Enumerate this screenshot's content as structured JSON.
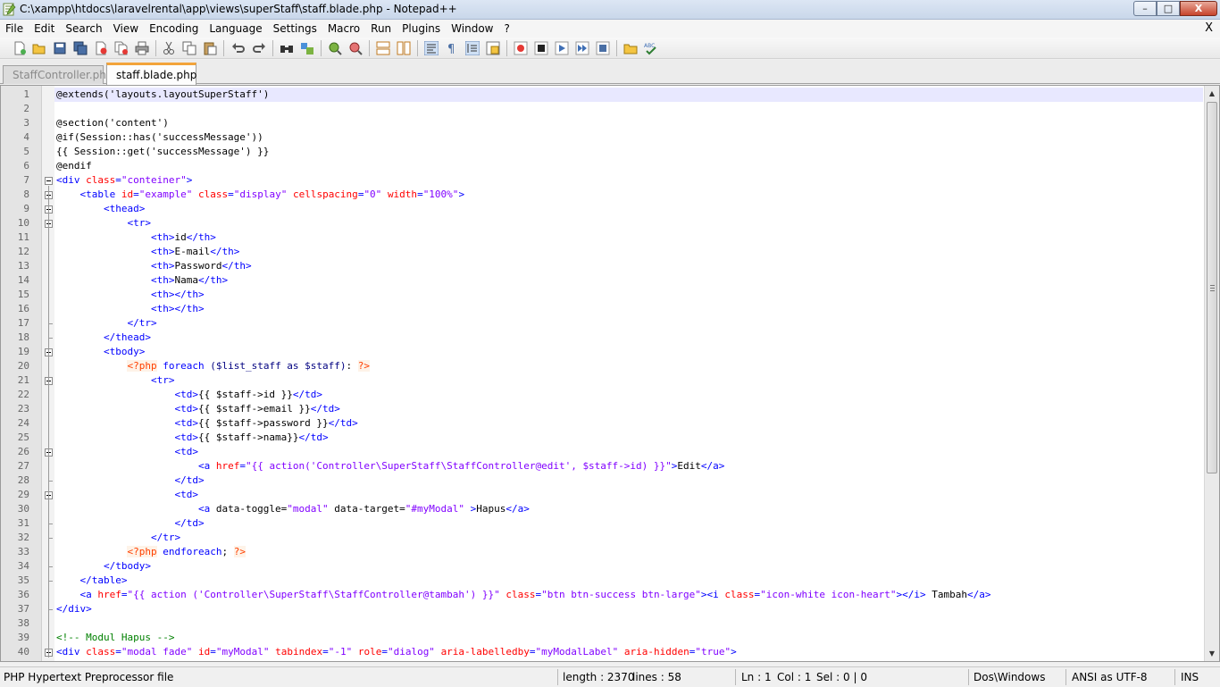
{
  "window": {
    "title": "C:\\xampp\\htdocs\\laravelrental\\app\\views\\superStaff\\staff.blade.php - Notepad++",
    "min_glyph": "–",
    "max_glyph": "□",
    "close_glyph": "X"
  },
  "menu": {
    "items": [
      "File",
      "Edit",
      "Search",
      "View",
      "Encoding",
      "Language",
      "Settings",
      "Macro",
      "Run",
      "Plugins",
      "Window",
      "?"
    ],
    "close_label": "X"
  },
  "toolbar": {
    "buttons": [
      "new-file",
      "open-file",
      "save",
      "save-all",
      "close",
      "close-all",
      "print",
      "cut",
      "copy",
      "paste",
      "undo",
      "redo",
      "find",
      "replace",
      "zoom-in",
      "zoom-out",
      "sync-vertical",
      "sync-horizontal",
      "word-wrap",
      "show-all-chars",
      "indent-guide",
      "user-defined-lang",
      "record-macro",
      "stop-record",
      "play-macro",
      "run-macro-multiple",
      "save-macro",
      "folder-as-workspace",
      "spell-check"
    ]
  },
  "tabs": [
    {
      "label": "StaffController.php",
      "active": false
    },
    {
      "label": "staff.blade.php",
      "active": true
    }
  ],
  "editor": {
    "current_line": 1,
    "lines": [
      {
        "n": "1",
        "indent": 0,
        "tokens": [
          [
            "t",
            "@extends('layouts.layoutSuperStaff')"
          ]
        ]
      },
      {
        "n": "2",
        "indent": 0,
        "tokens": []
      },
      {
        "n": "3",
        "indent": 0,
        "tokens": [
          [
            "t",
            "@section('content')"
          ]
        ]
      },
      {
        "n": "4",
        "indent": 0,
        "tokens": [
          [
            "t",
            "@if(Session::has('successMessage'))"
          ]
        ]
      },
      {
        "n": "5",
        "indent": 0,
        "tokens": [
          [
            "t",
            "{{ Session::get('successMessage') }}"
          ]
        ]
      },
      {
        "n": "6",
        "indent": 0,
        "tokens": [
          [
            "t",
            "@endif"
          ]
        ]
      },
      {
        "n": "7",
        "indent": 0,
        "tokens": [
          [
            "g",
            "<div "
          ],
          [
            "a",
            "class"
          ],
          [
            "g",
            "="
          ],
          [
            "s",
            "\"conteiner\""
          ],
          [
            "g",
            ">"
          ]
        ]
      },
      {
        "n": "8",
        "indent": 4,
        "tokens": [
          [
            "g",
            "<table "
          ],
          [
            "a",
            "id"
          ],
          [
            "g",
            "="
          ],
          [
            "s",
            "\"example\""
          ],
          [
            "g",
            " "
          ],
          [
            "a",
            "class"
          ],
          [
            "g",
            "="
          ],
          [
            "s",
            "\"display\""
          ],
          [
            "g",
            " "
          ],
          [
            "a",
            "cellspacing"
          ],
          [
            "g",
            "="
          ],
          [
            "s",
            "\"0\""
          ],
          [
            "g",
            " "
          ],
          [
            "a",
            "width"
          ],
          [
            "g",
            "="
          ],
          [
            "s",
            "\"100%\""
          ],
          [
            "g",
            ">"
          ]
        ]
      },
      {
        "n": "9",
        "indent": 8,
        "tokens": [
          [
            "g",
            "<thead>"
          ]
        ]
      },
      {
        "n": "10",
        "indent": 12,
        "tokens": [
          [
            "g",
            "<tr>"
          ]
        ]
      },
      {
        "n": "11",
        "indent": 16,
        "tokens": [
          [
            "g",
            "<th>"
          ],
          [
            "t",
            "id"
          ],
          [
            "g",
            "</th>"
          ]
        ]
      },
      {
        "n": "12",
        "indent": 16,
        "tokens": [
          [
            "g",
            "<th>"
          ],
          [
            "t",
            "E-mail"
          ],
          [
            "g",
            "</th>"
          ]
        ]
      },
      {
        "n": "13",
        "indent": 16,
        "tokens": [
          [
            "g",
            "<th>"
          ],
          [
            "t",
            "Password"
          ],
          [
            "g",
            "</th>"
          ]
        ]
      },
      {
        "n": "14",
        "indent": 16,
        "tokens": [
          [
            "g",
            "<th>"
          ],
          [
            "t",
            "Nama"
          ],
          [
            "g",
            "</th>"
          ]
        ]
      },
      {
        "n": "15",
        "indent": 16,
        "tokens": [
          [
            "g",
            "<th></th>"
          ]
        ]
      },
      {
        "n": "16",
        "indent": 16,
        "tokens": [
          [
            "g",
            "<th></th>"
          ]
        ]
      },
      {
        "n": "17",
        "indent": 12,
        "tokens": [
          [
            "g",
            "</tr>"
          ]
        ]
      },
      {
        "n": "18",
        "indent": 8,
        "tokens": [
          [
            "g",
            "</thead>"
          ]
        ]
      },
      {
        "n": "19",
        "indent": 8,
        "tokens": [
          [
            "g",
            "<tbody>"
          ]
        ]
      },
      {
        "n": "20",
        "indent": 12,
        "tokens": [
          [
            "p",
            "<?php"
          ],
          [
            "t",
            " "
          ],
          [
            "k",
            "foreach"
          ],
          [
            "t",
            " "
          ],
          [
            "v",
            "($list_staff as $staff)"
          ],
          [
            "t",
            ": "
          ],
          [
            "p",
            "?>"
          ]
        ]
      },
      {
        "n": "21",
        "indent": 16,
        "tokens": [
          [
            "g",
            "<tr>"
          ]
        ]
      },
      {
        "n": "22",
        "indent": 20,
        "tokens": [
          [
            "g",
            "<td>"
          ],
          [
            "t",
            "{{ $staff->id }}"
          ],
          [
            "g",
            "</td>"
          ]
        ]
      },
      {
        "n": "23",
        "indent": 20,
        "tokens": [
          [
            "g",
            "<td>"
          ],
          [
            "t",
            "{{ $staff->email }}"
          ],
          [
            "g",
            "</td>"
          ]
        ]
      },
      {
        "n": "24",
        "indent": 20,
        "tokens": [
          [
            "g",
            "<td>"
          ],
          [
            "t",
            "{{ $staff->password }}"
          ],
          [
            "g",
            "</td>"
          ]
        ]
      },
      {
        "n": "25",
        "indent": 20,
        "tokens": [
          [
            "g",
            "<td>"
          ],
          [
            "t",
            "{{ $staff->nama}}"
          ],
          [
            "g",
            "</td>"
          ]
        ]
      },
      {
        "n": "26",
        "indent": 20,
        "tokens": [
          [
            "g",
            "<td>"
          ]
        ]
      },
      {
        "n": "27",
        "indent": 24,
        "tokens": [
          [
            "g",
            "<a "
          ],
          [
            "a",
            "href"
          ],
          [
            "g",
            "="
          ],
          [
            "s",
            "\"{{ action('Controller\\SuperStaff\\StaffController@edit', $staff->id) }}\""
          ],
          [
            "g",
            ">"
          ],
          [
            "t",
            "Edit"
          ],
          [
            "g",
            "</a>"
          ]
        ]
      },
      {
        "n": "28",
        "indent": 20,
        "tokens": [
          [
            "g",
            "</td>"
          ]
        ]
      },
      {
        "n": "29",
        "indent": 20,
        "tokens": [
          [
            "g",
            "<td>"
          ]
        ]
      },
      {
        "n": "30",
        "indent": 24,
        "tokens": [
          [
            "g",
            "<a "
          ],
          [
            "t",
            "data-toggle="
          ],
          [
            "s",
            "\"modal\""
          ],
          [
            "t",
            " data-target="
          ],
          [
            "s",
            "\"#myModal\""
          ],
          [
            "t",
            " "
          ],
          [
            "g",
            ">"
          ],
          [
            "t",
            "Hapus"
          ],
          [
            "g",
            "</a>"
          ]
        ]
      },
      {
        "n": "31",
        "indent": 20,
        "tokens": [
          [
            "g",
            "</td>"
          ]
        ]
      },
      {
        "n": "32",
        "indent": 16,
        "tokens": [
          [
            "g",
            "</tr>"
          ]
        ]
      },
      {
        "n": "33",
        "indent": 12,
        "tokens": [
          [
            "p",
            "<?php"
          ],
          [
            "t",
            " "
          ],
          [
            "k",
            "endforeach"
          ],
          [
            "t",
            "; "
          ],
          [
            "p",
            "?>"
          ]
        ]
      },
      {
        "n": "34",
        "indent": 8,
        "tokens": [
          [
            "g",
            "</tbody>"
          ]
        ]
      },
      {
        "n": "35",
        "indent": 4,
        "tokens": [
          [
            "g",
            "</table>"
          ]
        ]
      },
      {
        "n": "36",
        "indent": 4,
        "tokens": [
          [
            "g",
            "<a "
          ],
          [
            "a",
            "href"
          ],
          [
            "g",
            "="
          ],
          [
            "s",
            "\"{{ action ('Controller\\SuperStaff\\StaffController@tambah') }}\""
          ],
          [
            "g",
            " "
          ],
          [
            "a",
            "class"
          ],
          [
            "g",
            "="
          ],
          [
            "s",
            "\"btn btn-success btn-large\""
          ],
          [
            "g",
            "><i "
          ],
          [
            "a",
            "class"
          ],
          [
            "g",
            "="
          ],
          [
            "s",
            "\"icon-white icon-heart\""
          ],
          [
            "g",
            "></i>"
          ],
          [
            "t",
            " Tambah"
          ],
          [
            "g",
            "</a>"
          ]
        ]
      },
      {
        "n": "37",
        "indent": 0,
        "tokens": [
          [
            "g",
            "</div>"
          ]
        ]
      },
      {
        "n": "38",
        "indent": 0,
        "tokens": []
      },
      {
        "n": "39",
        "indent": 0,
        "tokens": [
          [
            "c",
            "<!-- Modul Hapus -->"
          ]
        ]
      },
      {
        "n": "40",
        "indent": 0,
        "tokens": [
          [
            "g",
            "<div "
          ],
          [
            "a",
            "class"
          ],
          [
            "g",
            "="
          ],
          [
            "s",
            "\"modal fade\""
          ],
          [
            "g",
            " "
          ],
          [
            "a",
            "id"
          ],
          [
            "g",
            "="
          ],
          [
            "s",
            "\"myModal\""
          ],
          [
            "g",
            " "
          ],
          [
            "a",
            "tabindex"
          ],
          [
            "g",
            "="
          ],
          [
            "s",
            "\"-1\""
          ],
          [
            "g",
            " "
          ],
          [
            "a",
            "role"
          ],
          [
            "g",
            "="
          ],
          [
            "s",
            "\"dialog\""
          ],
          [
            "g",
            " "
          ],
          [
            "a",
            "aria-labelledby"
          ],
          [
            "g",
            "="
          ],
          [
            "s",
            "\"myModalLabel\""
          ],
          [
            "g",
            " "
          ],
          [
            "a",
            "aria-hidden"
          ],
          [
            "g",
            "="
          ],
          [
            "s",
            "\"true\""
          ],
          [
            "g",
            ">"
          ]
        ]
      }
    ],
    "fold_points": [
      "7",
      "8",
      "9",
      "10",
      "19",
      "21",
      "26",
      "29",
      "40"
    ],
    "fold_ends": [
      "17",
      "18",
      "28",
      "31",
      "32",
      "34",
      "35",
      "37"
    ]
  },
  "status": {
    "file_type": "PHP Hypertext Preprocessor file",
    "length": "length : 2370",
    "lines": "lines : 58",
    "ln": "Ln : 1",
    "col": "Col : 1",
    "sel": "Sel : 0 | 0",
    "eol": "Dos\\Windows",
    "encoding": "ANSI as UTF-8",
    "mode": "INS"
  },
  "colors": {
    "tag": "#0000ff",
    "attribute": "#ff0000",
    "string": "#8000ff",
    "php_delim": "#ff4000",
    "comment": "#008000",
    "active_tab_accent": "#f3a43a",
    "current_line": "#e8e8ff"
  }
}
